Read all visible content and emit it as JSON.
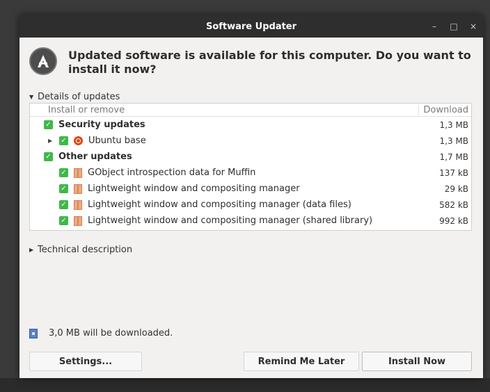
{
  "window": {
    "title": "Software Updater",
    "controls": {
      "minimize": "–",
      "maximize": "□",
      "close": "×"
    }
  },
  "header": {
    "headline_line1": "Updated software is available for this computer. Do you want to",
    "headline_line2": "install it now?",
    "icon": "software-updater-icon"
  },
  "details": {
    "label": "Details of updates",
    "expanded": true,
    "columns": {
      "name": "Install or remove",
      "size": "Download"
    },
    "groups": [
      {
        "label": "Security updates",
        "size": "1,3 MB",
        "checked": true,
        "items": [
          {
            "label": "Ubuntu base",
            "size": "1,3 MB",
            "checked": true,
            "icon": "ubuntu-icon",
            "collapsible": true
          }
        ]
      },
      {
        "label": "Other updates",
        "size": "1,7 MB",
        "checked": true,
        "items": [
          {
            "label": "GObject introspection data for Muffin",
            "size": "137 kB",
            "checked": true,
            "icon": "package-icon"
          },
          {
            "label": "Lightweight window and compositing manager",
            "size": "29 kB",
            "checked": true,
            "icon": "package-icon"
          },
          {
            "label": "Lightweight window and compositing manager (data files)",
            "size": "582 kB",
            "checked": true,
            "icon": "package-icon"
          },
          {
            "label": "Lightweight window and compositing manager (shared library)",
            "size": "992 kB",
            "checked": true,
            "icon": "package-icon"
          }
        ]
      }
    ]
  },
  "technical": {
    "label": "Technical description",
    "expanded": false
  },
  "status": {
    "text": "3,0 MB will be downloaded."
  },
  "buttons": {
    "settings": "Settings...",
    "remind": "Remind Me Later",
    "install": "Install Now"
  },
  "colors": {
    "check": "#3fb84a",
    "titlebar": "#2e2e2e",
    "window_bg": "#f2f1f0"
  }
}
